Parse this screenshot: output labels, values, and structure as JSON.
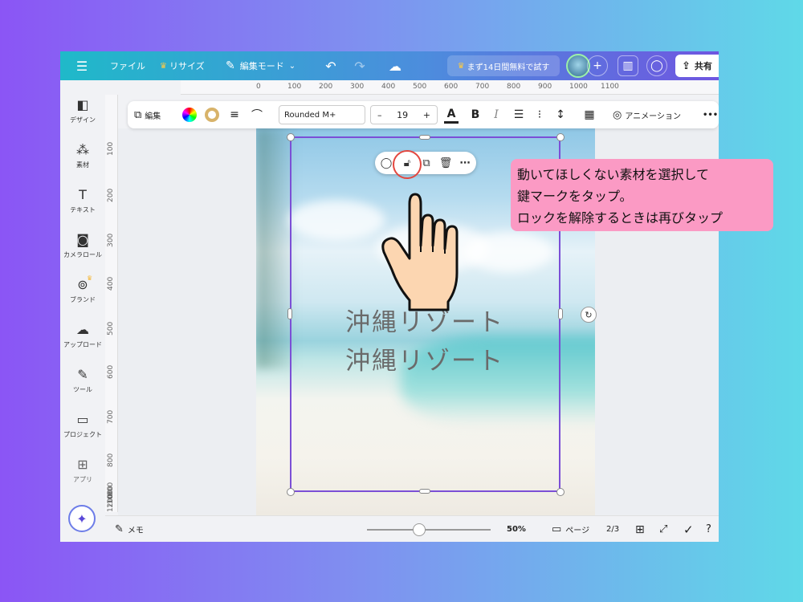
{
  "topbar": {
    "menu_icon": "hamburger-icon",
    "file": "ファイル",
    "resize": "リサイズ",
    "edit_mode": "編集モード",
    "trial": "まず14日間無料で試す",
    "share": "共有"
  },
  "ruler": {
    "top": [
      "0",
      "100",
      "200",
      "300",
      "400",
      "500",
      "600",
      "700",
      "800",
      "900",
      "1000",
      "1100"
    ],
    "left": [
      "100",
      "200",
      "300",
      "400",
      "500",
      "600",
      "700",
      "800",
      "900",
      "1000",
      "1100",
      "1200"
    ]
  },
  "sidebar": {
    "items": [
      {
        "label": "デザイン",
        "icon": "design-icon"
      },
      {
        "label": "素材",
        "icon": "elements-icon"
      },
      {
        "label": "テキスト",
        "icon": "text-icon"
      },
      {
        "label": "カメラロール",
        "icon": "camera-icon"
      },
      {
        "label": "ブランド",
        "icon": "brand-icon"
      },
      {
        "label": "アップロード",
        "icon": "upload-icon"
      },
      {
        "label": "ツール",
        "icon": "tools-icon"
      },
      {
        "label": "プロジェクト",
        "icon": "folder-icon"
      },
      {
        "label": "アプリ",
        "icon": "apps-icon"
      }
    ]
  },
  "textbar": {
    "edit": "編集",
    "font": "Rounded M+",
    "minus": "–",
    "size": "19",
    "plus": "+",
    "color_letter": "A",
    "bold": "B",
    "italic": "I",
    "animation": "アニメーション",
    "more": "•••"
  },
  "canvas": {
    "headline_1": "沖縄リゾート",
    "headline_2": "沖縄リゾート"
  },
  "callout": {
    "line1": "動いてほしくない素材を選択して",
    "line2": "鍵マークをタップ。",
    "line3": "ロックを解除するときは再びタップ"
  },
  "bottombar": {
    "notes": "メモ",
    "zoom": "50%",
    "pages_label": "ページ",
    "page_count": "2/3"
  },
  "colors": {
    "accent": "#7b4fd6",
    "callout": "#fb9ac4",
    "lock_ring": "#e3473f"
  }
}
